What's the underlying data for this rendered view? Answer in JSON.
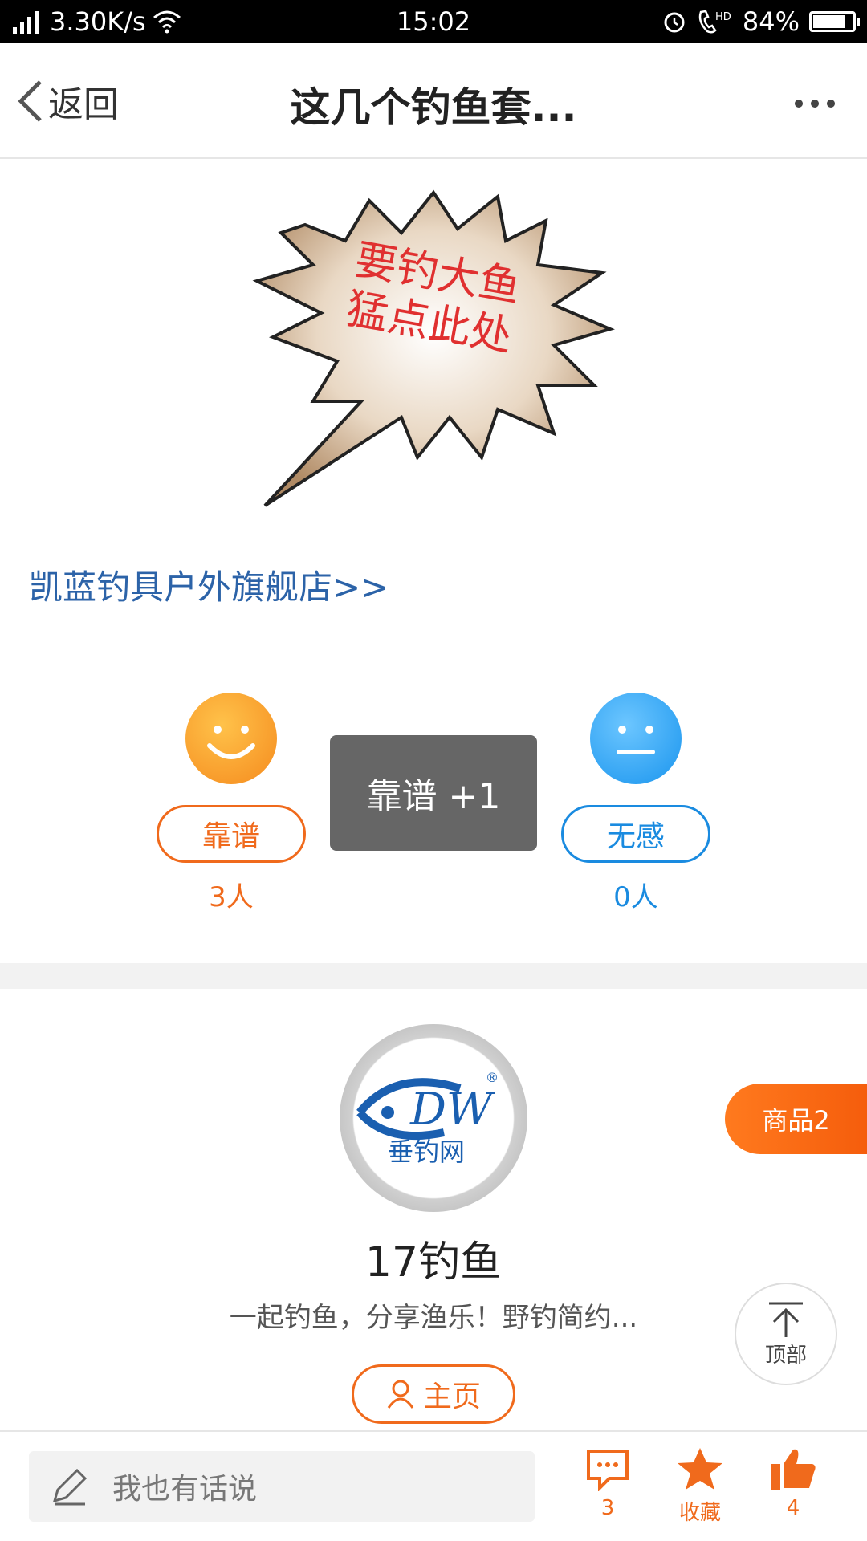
{
  "status_bar": {
    "network": "4G",
    "speed": "3.30K/s",
    "time": "15:02",
    "hd": "HD",
    "battery": "84%",
    "battery_level": 0.84
  },
  "nav": {
    "back_label": "返回",
    "title": "这几个钓鱼套..."
  },
  "promo": {
    "line1": "要钓大鱼",
    "line2": "猛点此处"
  },
  "store_link": "凯蓝钓具户外旗舰店>>",
  "votes": {
    "good_label": "靠谱",
    "good_count": "3人",
    "none_label": "无感",
    "none_count": "0人",
    "toast": "靠谱 +1"
  },
  "author": {
    "logo_text": "DW",
    "logo_reg": "®",
    "logo_sub": "垂钓网",
    "name": "17钓鱼",
    "description": "一起钓鱼，分享渔乐！野钓简约...",
    "home_label": "主页"
  },
  "goods_tab": "商品2",
  "top_button": "顶部",
  "bottom_bar": {
    "placeholder": "我也有话说",
    "comment_count": "3",
    "favorite_label": "收藏",
    "like_count": "4"
  },
  "colors": {
    "accent": "#f06a1c",
    "blue": "#1a8be0",
    "link": "#2c63a8"
  }
}
